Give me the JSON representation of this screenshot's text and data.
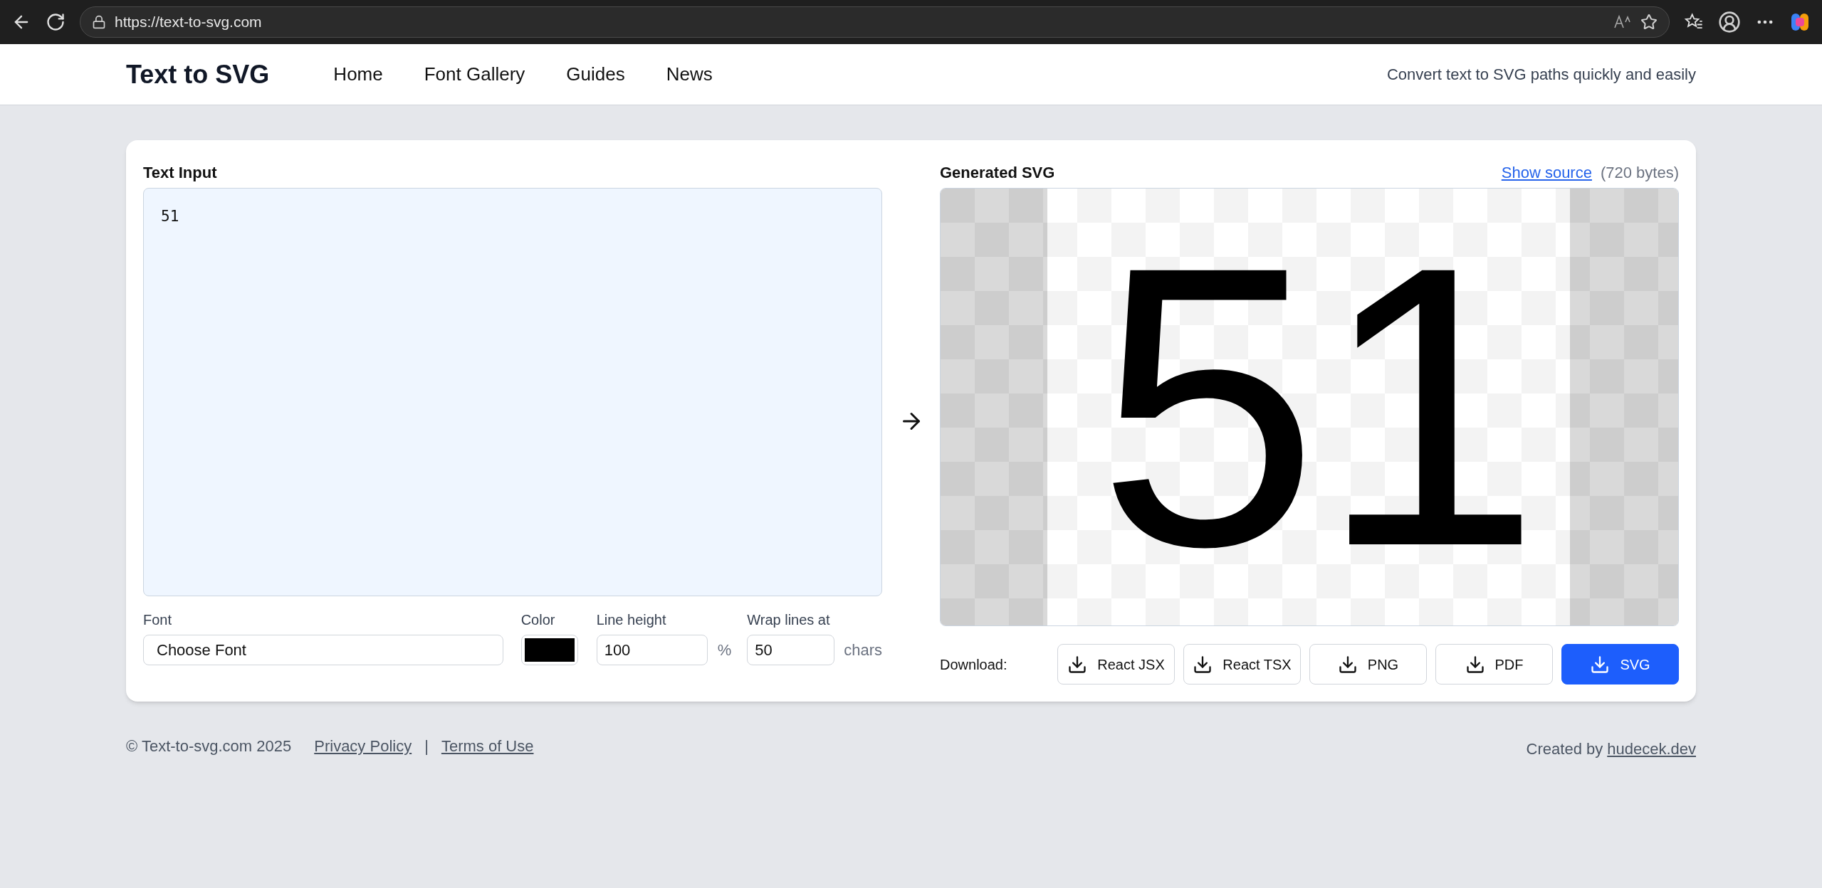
{
  "browser": {
    "url": "https://text-to-svg.com"
  },
  "header": {
    "logo": "Text to SVG",
    "nav": [
      {
        "label": "Home"
      },
      {
        "label": "Font Gallery"
      },
      {
        "label": "Guides"
      },
      {
        "label": "News"
      }
    ],
    "tagline": "Convert text to SVG paths quickly and easily"
  },
  "input_panel": {
    "title": "Text Input",
    "text": "51",
    "font": {
      "label": "Font",
      "value": "Choose Font"
    },
    "color": {
      "label": "Color",
      "color": "#000000"
    },
    "line_height": {
      "label": "Line height",
      "value": "100",
      "unit": "%"
    },
    "wrap": {
      "label": "Wrap lines at",
      "value": "50",
      "unit": "chars"
    }
  },
  "output_panel": {
    "title": "Generated SVG",
    "show_source": "Show source",
    "size": "(720 bytes)",
    "preview_text": "51",
    "download_label": "Download:",
    "downloads": [
      {
        "label": "React JSX",
        "kind": "secondary"
      },
      {
        "label": "React TSX",
        "kind": "secondary"
      },
      {
        "label": "PNG",
        "kind": "secondary"
      },
      {
        "label": "PDF",
        "kind": "secondary"
      },
      {
        "label": "SVG",
        "kind": "primary"
      }
    ]
  },
  "footer": {
    "copyright": "© Text-to-svg.com 2025",
    "links": [
      {
        "label": "Privacy Policy"
      },
      {
        "label": "Terms of Use"
      }
    ],
    "separator": "|",
    "credit": "Created by",
    "credit_link": "hudecek.dev"
  }
}
